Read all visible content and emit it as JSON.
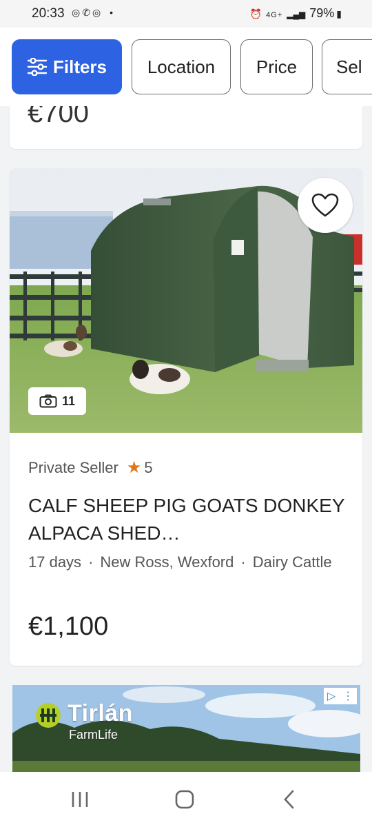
{
  "status_bar": {
    "time": "20:33",
    "left_icons": [
      "chrome-icon",
      "whatsapp-icon",
      "chrome-icon",
      "dot-icon"
    ],
    "network": "4G+",
    "battery": "79%"
  },
  "filters": {
    "filters_label": "Filters",
    "location_label": "Location",
    "price_label": "Price",
    "sell_label": "Sel"
  },
  "previous_listing": {
    "price": "€700"
  },
  "listing": {
    "photo_count": "11",
    "seller": "Private Seller",
    "rating": "5",
    "title": "CALF SHEEP PIG GOATS DONKEY ALPACA SHED…",
    "age": "17 days",
    "location": "New Ross, Wexford",
    "category": "Dairy Cattle",
    "price": "€1,100"
  },
  "ad": {
    "brand": "Tirlán",
    "sub": "FarmLife"
  },
  "colors": {
    "accent": "#2d62e2",
    "star": "#e0761c",
    "shelter_green": "#3f5a3f"
  }
}
